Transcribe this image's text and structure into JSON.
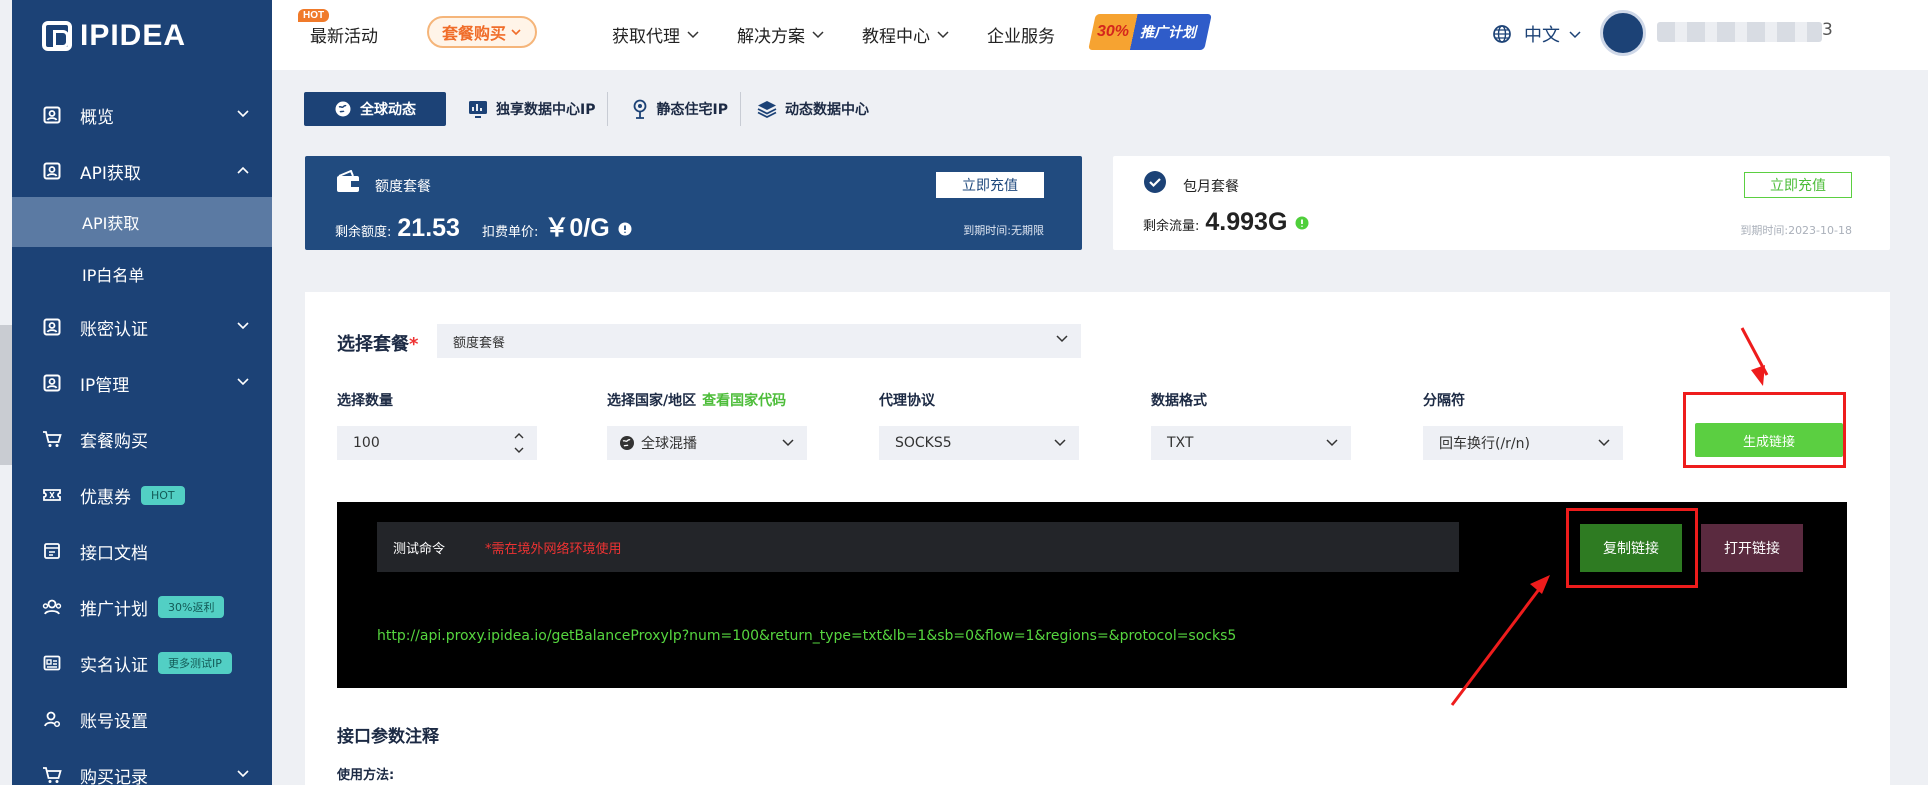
{
  "brand": {
    "name": "IPIDEA"
  },
  "sidebar": {
    "items": [
      {
        "label": "概览",
        "icon": "user-square-icon"
      },
      {
        "label": "API获取",
        "icon": "user-square-icon"
      },
      {
        "label": "账密认证",
        "icon": "user-square-icon"
      },
      {
        "label": "IP管理",
        "icon": "user-square-icon"
      },
      {
        "label": "套餐购买",
        "icon": "cart-icon"
      },
      {
        "label": "优惠券",
        "icon": "coupon-icon",
        "tag": "HOT"
      },
      {
        "label": "接口文档",
        "icon": "document-icon"
      },
      {
        "label": "推广计划",
        "icon": "users-icon",
        "tag": "30%返利"
      },
      {
        "label": "实名认证",
        "icon": "id-card-icon",
        "tag": "更多测试IP"
      },
      {
        "label": "账号设置",
        "icon": "user-gear-icon"
      },
      {
        "label": "购买记录",
        "icon": "cart-icon"
      }
    ],
    "sub_items": [
      {
        "label": "API获取",
        "active": true
      },
      {
        "label": "IP白名单",
        "active": false
      }
    ]
  },
  "topbar": {
    "hot_badge": "HOT",
    "latest": "最新活动",
    "buy": "套餐购买",
    "get_proxy": "获取代理",
    "solutions": "解决方案",
    "tutorials": "教程中心",
    "enterprise": "企业服务",
    "promo_number": "30%",
    "promo_text": "推广计划",
    "lang": "中文",
    "user_suffix": "3"
  },
  "tabs": [
    {
      "label": "全球动态",
      "icon": "globe-icon",
      "active": true
    },
    {
      "label": "独享数据中心IP",
      "icon": "chart-icon",
      "active": false
    },
    {
      "label": "静态住宅IP",
      "icon": "pin-icon",
      "active": false
    },
    {
      "label": "动态数据中心",
      "icon": "layers-icon",
      "active": false
    }
  ],
  "card_quota": {
    "title": "额度套餐",
    "remaining_label": "剩余额度:",
    "remaining_value": "21.53",
    "price_label": "扣费单价:",
    "price_value": "￥0/G",
    "button": "立即充值",
    "expiry": "到期时间:无期限"
  },
  "card_monthly": {
    "title": "包月套餐",
    "remaining_label": "剩余流量:",
    "remaining_value": "4.993G",
    "button": "立即充值",
    "expiry": "到期时间:2023-10-18"
  },
  "form": {
    "package_label": "选择套餐",
    "required_mark": "*",
    "package_value": "额度套餐",
    "quantity_label": "选择数量",
    "quantity_value": "100",
    "country_label": "选择国家/地区",
    "country_link": "查看国家代码",
    "country_value": "全球混播",
    "protocol_label": "代理协议",
    "protocol_value": "SOCKS5",
    "format_label": "数据格式",
    "format_value": "TXT",
    "separator_label": "分隔符",
    "separator_value": "回车换行(/r/n)",
    "generate_button": "生成链接"
  },
  "console": {
    "cmd_label": "测试命令",
    "warning": "*需在境外网络环境使用",
    "copy_button": "复制链接",
    "open_button": "打开链接",
    "url": "http://api.proxy.ipidea.io/getBalanceProxyIp?num=100&return_type=txt&lb=1&sb=0&flow=1&regions=&protocol=socks5"
  },
  "params": {
    "title": "接口参数注释",
    "usage": "使用方法:"
  },
  "colors": {
    "sidebar": "#1c4276",
    "accent_green": "#5bcf41",
    "annotation_red": "#ee1c1c"
  }
}
